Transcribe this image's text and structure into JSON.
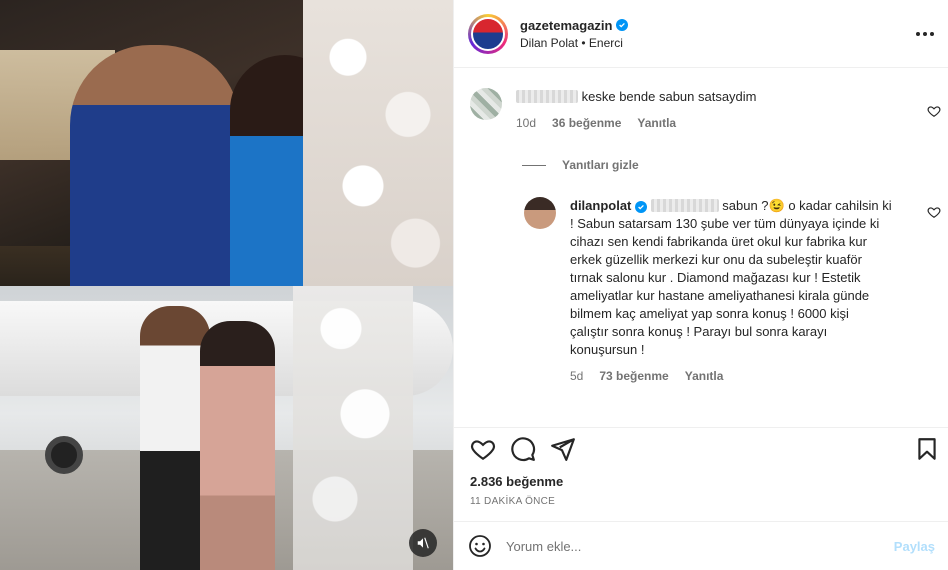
{
  "post": {
    "author": {
      "username": "gazetemagazin",
      "subtitle": "Dilan Polat • Enerci",
      "verified": true
    },
    "likes_text": "2.836 beğenme",
    "time_text": "11 DAKİKA ÖNCE"
  },
  "comments": [
    {
      "username_hidden": true,
      "text": "keske bende sabun satsaydim",
      "age": "10d",
      "likes": "36 beğenme",
      "reply_label": "Yanıtla"
    }
  ],
  "hide_replies_label": "Yanıtları gizle",
  "reply": {
    "username": "dilanpolat",
    "verified": true,
    "text_part1": "sabun ?😉 o kadar cahilsin ki",
    "lines": [
      "! Sabun satarsam 130 şube ver tüm dünyaya içinde ki",
      "cihazı sen kendi fabrikanda üret okul kur fabrika kur",
      "erkek güzellik merkezi kur onu da subeleştir kuaför",
      "tırnak salonu kur . Diamond mağazası kur ! Estetik",
      "ameliyatlar kur hastane ameliyathanesi kirala günde",
      "bilmem kaç ameliyat yap sonra konuş ! 6000 kişi",
      "çalıştır sonra konuş ! Parayı bul sonra karayı",
      "konuşursun !"
    ],
    "age": "5d",
    "likes": "73 beğenme",
    "reply_label": "Yanıtla"
  },
  "composer": {
    "placeholder": "Yorum ekle...",
    "post_label": "Paylaş"
  },
  "colors": {
    "verified": "#0095f6",
    "text": "#262626",
    "muted": "#737373",
    "post_disabled": "#b2dffc"
  },
  "icons": [
    "mute-icon",
    "more-icon",
    "heart-icon",
    "comment-icon",
    "share-icon",
    "bookmark-icon",
    "emoji-icon"
  ]
}
